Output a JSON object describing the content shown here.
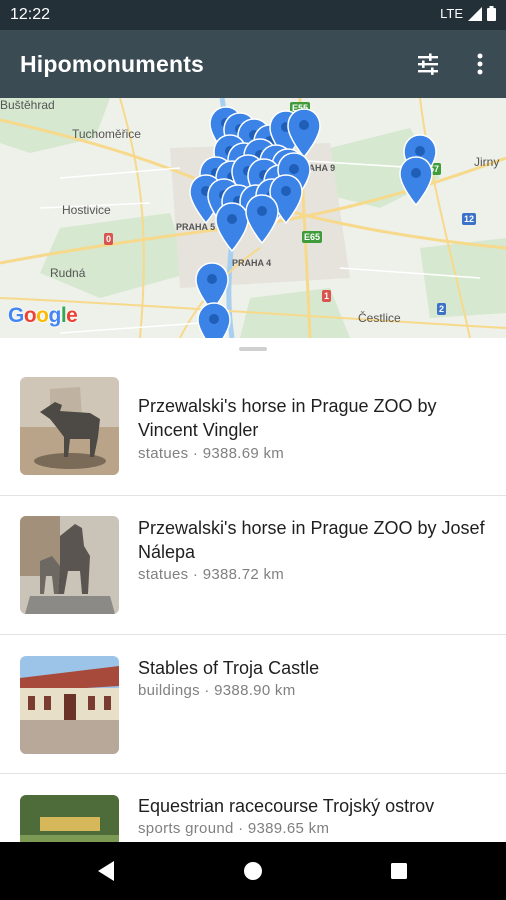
{
  "status": {
    "time": "12:22",
    "network": "LTE"
  },
  "appbar": {
    "title": "Hipomonuments",
    "filter_icon": "tune-icon",
    "menu_icon": "more-vert-icon"
  },
  "map": {
    "labels": {
      "bustehrad": "Buštěhrad",
      "tuchomerice": "Tuchoměřice",
      "hostivice": "Hostivice",
      "rudna": "Rudná",
      "jirny": "Jirny",
      "cestlice": "Čestlice",
      "praha9": "PRAHA 9",
      "praha5": "PRAHA 5",
      "praha4": "PRAHA 4",
      "praha_partial": "ha"
    },
    "badges": {
      "e55": "E55",
      "e65": "E65",
      "r0": "0",
      "r1": "1",
      "r2": "2",
      "r12": "12",
      "r57": "57"
    },
    "google": [
      "G",
      "o",
      "o",
      "g",
      "l",
      "e"
    ],
    "pin_color": "#3b83e6"
  },
  "list": [
    {
      "title": "Przewalski's horse in Prague ZOO by Vincent Vingler",
      "category": "statues",
      "distance": "9388.69 km",
      "meta": "statues · 9388.69 km"
    },
    {
      "title": "Przewalski's horse in Prague ZOO by Josef Nálepa",
      "category": "statues",
      "distance": "9388.72 km",
      "meta": "statues · 9388.72 km"
    },
    {
      "title": "Stables of Troja Castle",
      "category": "buildings",
      "distance": "9388.90 km",
      "meta": "buildings · 9388.90 km"
    },
    {
      "title": "Equestrian racecourse Trojský ostrov",
      "category": "sports ground",
      "distance": "9389.65 km",
      "meta": "sports ground · 9389.65 km"
    }
  ],
  "nav": {
    "back_icon": "back-icon",
    "home_icon": "home-icon",
    "recents_icon": "recents-icon"
  }
}
